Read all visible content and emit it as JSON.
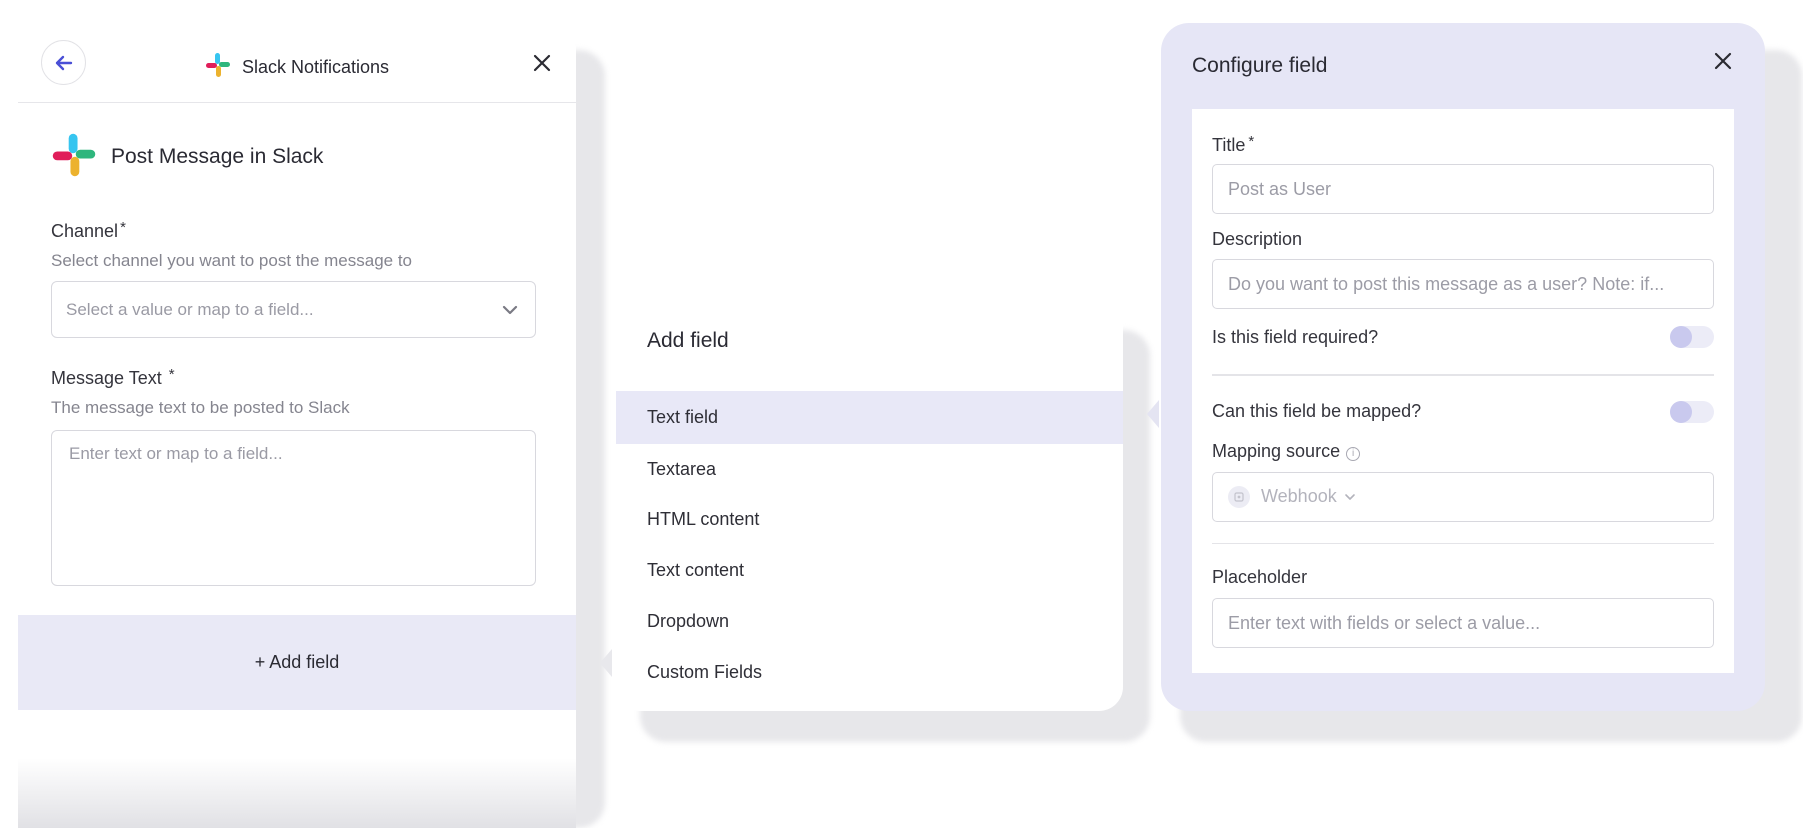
{
  "left_panel": {
    "header_title": "Slack Notifications",
    "action_title": "Post Message in Slack",
    "channel": {
      "label": "Channel",
      "required_mark": "*",
      "help": "Select channel you want to post the message to",
      "placeholder": "Select a value or map to a field..."
    },
    "message_text": {
      "label": "Message Text",
      "required_mark": "*",
      "help": "The message text to be posted to Slack",
      "placeholder": "Enter text or map to a field..."
    },
    "add_field_label": "+ Add field"
  },
  "add_field_menu": {
    "title": "Add field",
    "items": [
      "Text field",
      "Textarea",
      "HTML content",
      "Text content",
      "Dropdown",
      "Custom Fields"
    ],
    "active_index": 0
  },
  "configure_field": {
    "title": "Configure field",
    "title_field": {
      "label": "Title",
      "required_mark": "*",
      "placeholder": "Post as User"
    },
    "description_field": {
      "label": "Description",
      "placeholder": "Do you want to post this message as a user? Note: if..."
    },
    "required_toggle": {
      "label": "Is this field required?",
      "on": false
    },
    "mapped_toggle": {
      "label": "Can this field be mapped?",
      "on": false
    },
    "mapping_source": {
      "label": "Mapping source",
      "info_glyph": "i",
      "value": "Webhook"
    },
    "placeholder_field": {
      "label": "Placeholder",
      "placeholder": "Enter text with fields or select a value..."
    }
  },
  "colors": {
    "accent": "#4a4fd6",
    "highlight": "#e8e8f7",
    "panel_tint": "#e6e6f6",
    "toggle_knob": "#c9c9ee"
  }
}
